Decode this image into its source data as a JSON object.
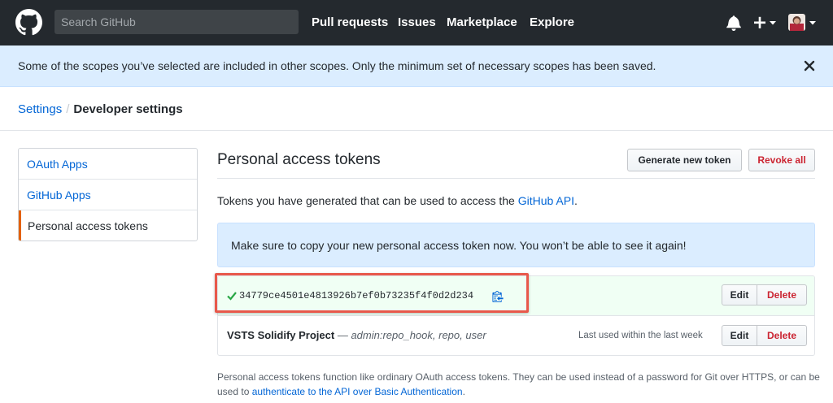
{
  "header": {
    "search_placeholder": "Search GitHub",
    "nav": [
      "Pull requests",
      "Issues",
      "Marketplace",
      "Explore"
    ]
  },
  "flash": {
    "message": "Some of the scopes you’ve selected are included in other scopes. Only the minimum set of necessary scopes has been saved."
  },
  "breadcrumb": {
    "parent": "Settings",
    "separator": "/",
    "current": "Developer settings"
  },
  "sidebar": {
    "items": [
      {
        "label": "OAuth Apps"
      },
      {
        "label": "GitHub Apps"
      },
      {
        "label": "Personal access tokens",
        "selected": true
      }
    ]
  },
  "main": {
    "title": "Personal access tokens",
    "generate_button": "Generate new token",
    "revoke_button": "Revoke all",
    "intro_text": "Tokens you have generated that can be used to access the",
    "intro_link": "GitHub API",
    "intro_end": ".",
    "notice": "Make sure to copy your new personal access token now. You won’t be able to see it again!",
    "new_token": {
      "value": "34779ce4501e4813926b7ef0b73235f4f0d2d234",
      "edit_label": "Edit",
      "delete_label": "Delete"
    },
    "existing_token": {
      "name": "VSTS Solidify Project",
      "separator": " — ",
      "scopes": "admin:repo_hook, repo, user",
      "last_used": "Last used within the last week",
      "edit_label": "Edit",
      "delete_label": "Delete"
    },
    "footer_text": "Personal access tokens function like ordinary OAuth access tokens. They can be used instead of a password for Git over HTTPS, or can be used to",
    "footer_link": "authenticate to the API over Basic Authentication",
    "footer_end": "."
  },
  "colors": {
    "header_bg": "#24292e",
    "link": "#0366d6",
    "flash_bg": "#dbedff",
    "new_token_bg": "#f0fff4",
    "danger": "#cb2431",
    "selected_accent": "#e36209",
    "highlight_box": "#e8584b"
  },
  "icons": [
    "github-logo-icon",
    "bell-icon",
    "plus-icon",
    "caret-down-icon",
    "avatar",
    "close-icon",
    "check-icon",
    "clippy-icon"
  ]
}
